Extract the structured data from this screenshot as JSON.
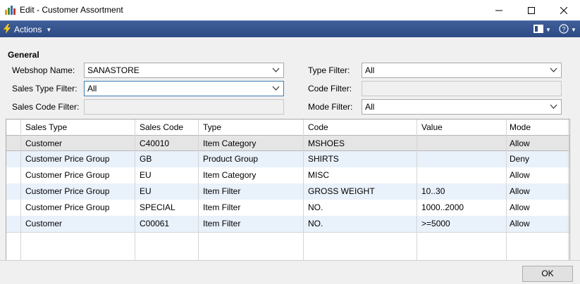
{
  "window": {
    "title": "Edit - Customer Assortment"
  },
  "actionbar": {
    "actions_label": "Actions"
  },
  "general": {
    "title": "General",
    "fields": {
      "webshop_name": {
        "label": "Webshop Name:",
        "value": "SANASTORE"
      },
      "sales_type_filter": {
        "label": "Sales Type Filter:",
        "value": "All"
      },
      "sales_code_filter": {
        "label": "Sales Code Filter:",
        "value": ""
      },
      "type_filter": {
        "label": "Type Filter:",
        "value": "All"
      },
      "code_filter": {
        "label": "Code Filter:",
        "value": ""
      },
      "mode_filter": {
        "label": "Mode Filter:",
        "value": "All"
      }
    }
  },
  "table": {
    "columns": [
      "Sales Type",
      "Sales Code",
      "Type",
      "Code",
      "Value",
      "Mode"
    ],
    "rows": [
      [
        "Customer",
        "C40010",
        "Item Category",
        "MSHOES",
        "",
        "Allow"
      ],
      [
        "Customer Price Group",
        "GB",
        "Product Group",
        "SHIRTS",
        "",
        "Deny"
      ],
      [
        "Customer Price Group",
        "EU",
        "Item Category",
        "MISC",
        "",
        "Allow"
      ],
      [
        "Customer Price Group",
        "EU",
        "Item Filter",
        "GROSS WEIGHT",
        "10..30",
        "Allow"
      ],
      [
        "Customer Price Group",
        "SPECIAL",
        "Item Filter",
        "NO.",
        "1000..2000",
        "Allow"
      ],
      [
        "Customer",
        "C00061",
        "Item Filter",
        "NO.",
        ">=5000",
        "Allow"
      ]
    ]
  },
  "footer": {
    "ok_label": "OK"
  },
  "colors": {
    "actionbar_bg": "#2d4a85",
    "alt_row": "#e9f1fb",
    "selected_row": "#e5e5e5",
    "focus_border": "#3c7fb1"
  },
  "icons": [
    "app-logo-icon",
    "minimize-icon",
    "maximize-icon",
    "close-icon",
    "lightning-icon",
    "layout-icon",
    "help-icon",
    "chevron-down-icon"
  ]
}
